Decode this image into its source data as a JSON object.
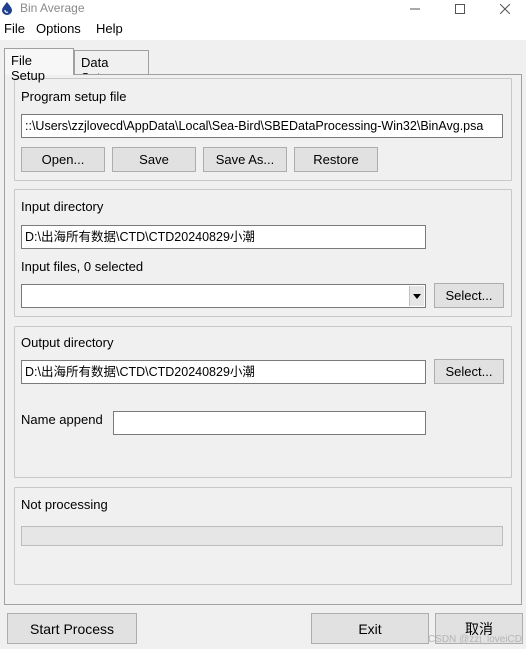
{
  "window": {
    "title": "Bin Average",
    "icon": "sea-bird-drop-icon"
  },
  "menu": [
    "File",
    "Options",
    "Help"
  ],
  "tabs": [
    {
      "label": "File Setup",
      "active": true
    },
    {
      "label": "Data Setup",
      "active": false
    }
  ],
  "program_setup": {
    "label": "Program setup file",
    "path": "::\\Users\\zzjlovecd\\AppData\\Local\\Sea-Bird\\SBEDataProcessing-Win32\\BinAvg.psa",
    "open_label": "Open...",
    "save_label": "Save",
    "save_as_label": "Save As...",
    "restore_label": "Restore"
  },
  "input": {
    "dir_label": "Input directory",
    "dir_value": "D:\\出海所有数据\\CTD\\CTD20240829小潮",
    "files_label": "Input files, 0 selected",
    "files_value": "",
    "select_label": "Select..."
  },
  "output": {
    "dir_label": "Output directory",
    "dir_value": "D:\\出海所有数据\\CTD\\CTD20240829小潮",
    "select_label": "Select...",
    "name_append_label": "Name append",
    "name_append_value": ""
  },
  "status": {
    "text": "Not processing",
    "progress": 0
  },
  "bottom": {
    "start_label": "Start Process",
    "exit_label": "Exit",
    "cancel_label": "取消"
  },
  "watermark": "CSDN @zzj_loveiCD",
  "colors": {
    "window_bg": "#f0f0f0",
    "button_bg": "#e1e1e1",
    "progress_fill": "#06b025"
  }
}
